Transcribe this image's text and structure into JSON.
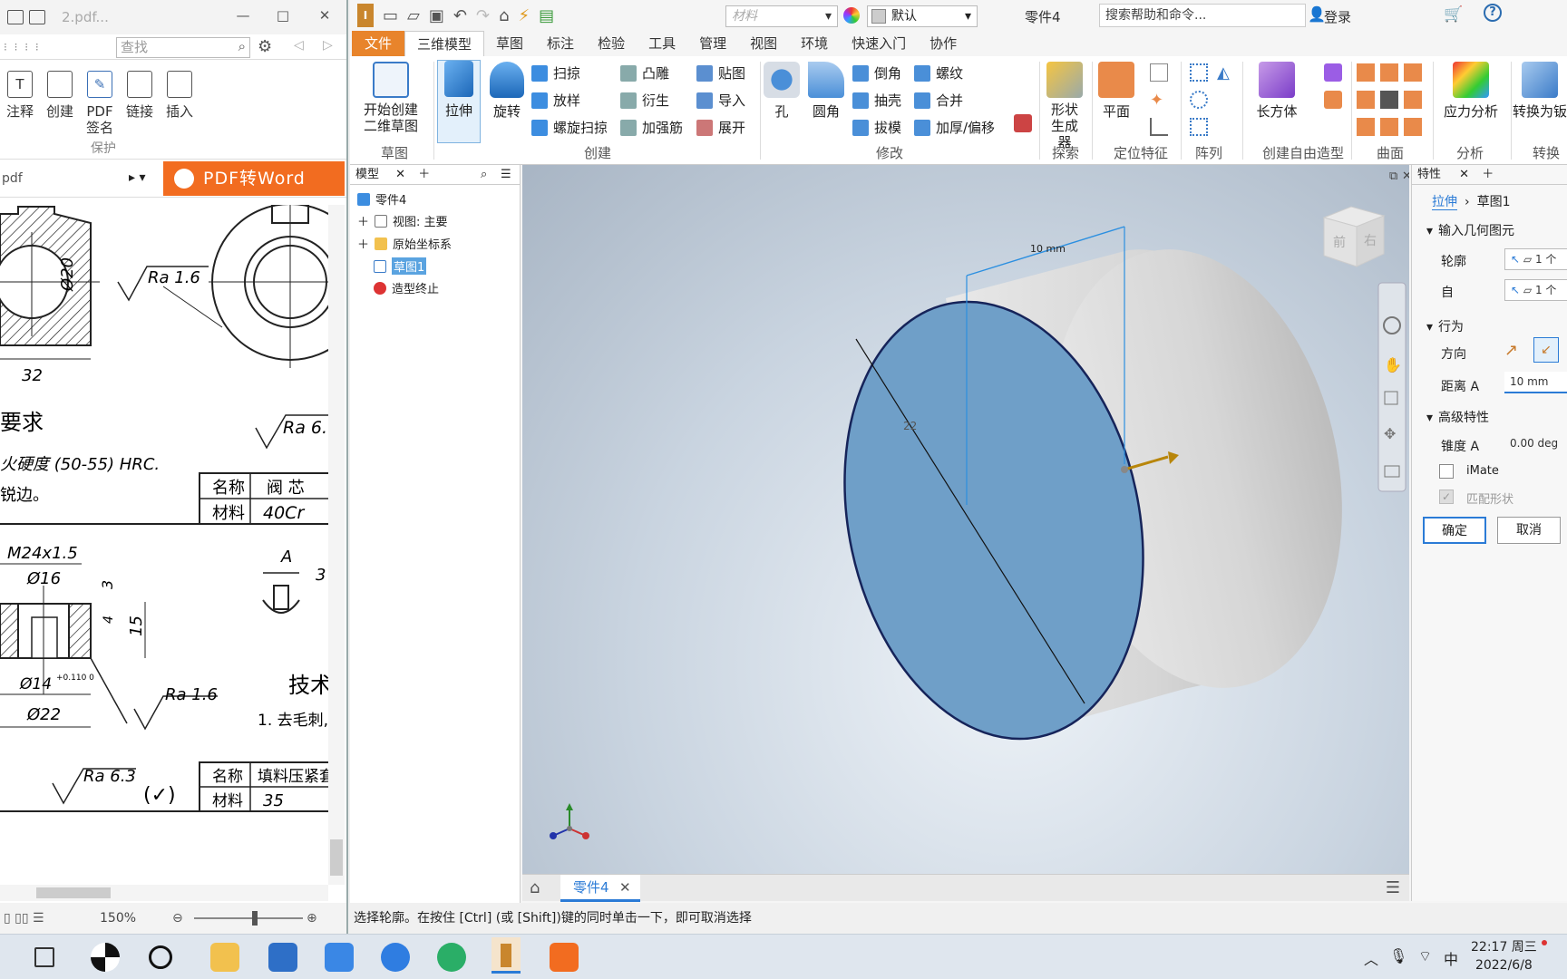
{
  "pdf_reader": {
    "file_name": "2.pdf...",
    "search_placeholder": "查找",
    "ribbon": [
      {
        "label": "注释",
        "icon": "text-icon"
      },
      {
        "label": "创建",
        "icon": "create-icon"
      },
      {
        "label": "PDF签名",
        "icon": "pen-icon"
      },
      {
        "label": "链接",
        "icon": "link-icon"
      },
      {
        "label": "插入",
        "icon": "insert-icon"
      }
    ],
    "ribbon_group": "保护",
    "tab_file": "pdf",
    "convert_banner": "PDF转Word",
    "zoom": "150%",
    "drawing": {
      "ra1": "Ra 1.6",
      "dia20": "Ø20",
      "dim32": "32",
      "req_title": "要求",
      "req_line1": "火硬度 (50-55) HRC.",
      "req_line2": "锐边。",
      "ra_top": "Ra 6.",
      "table1_r1": [
        "名称",
        "阀 芯"
      ],
      "table1_r2": [
        "材料",
        "40Cr"
      ],
      "thread": "M24x1.5",
      "dia16": "Ø16",
      "dim3": "3",
      "dim4": "4",
      "dim15": "15",
      "dia14": "Ø14",
      "tol": "+0.110 0",
      "dia22": "Ø22",
      "ra2": "Ra 1.6",
      "tech": "技术",
      "tech_line": "1. 去毛刺,",
      "sec_a": "A",
      "dim3b": "3",
      "ra63": "Ra 6.3",
      "check": "(✓)",
      "table2_r1": [
        "名称",
        "填料压紧套"
      ],
      "table2_r2": [
        "材料",
        "35"
      ]
    }
  },
  "inventor": {
    "material_placeholder": "材料",
    "appearance": "默认",
    "part_name": "零件4",
    "help_search": "搜索帮助和命令...",
    "login": "登录",
    "menu_tabs": [
      "文件",
      "三维模型",
      "草图",
      "标注",
      "检验",
      "工具",
      "管理",
      "视图",
      "环境",
      "快速入门",
      "协作"
    ],
    "active_tab": "三维模型",
    "ribbon": {
      "sketch_btn": "开始创建二维草图",
      "sketch_group": "草图",
      "extrude": "拉伸",
      "revolve": "旋转",
      "sweep": "扫掠",
      "loft": "放样",
      "coil": "螺旋扫掠",
      "emboss": "凸雕",
      "derive": "衍生",
      "rib": "加强筋",
      "decal": "贴图",
      "import": "导入",
      "unfold": "展开",
      "create_group": "创建",
      "hole": "孔",
      "fillet": "圆角",
      "chamfer": "倒角",
      "shell": "抽壳",
      "draft": "拔模",
      "thread": "螺纹",
      "combine": "合并",
      "thicken": "加厚/偏移",
      "modify_group": "修改",
      "shape_gen": "形状生成器",
      "explore_group": "探索",
      "plane": "平面",
      "workfeat_group": "定位特征",
      "pattern_group": "阵列",
      "box": "长方体",
      "freeform_group": "创建自由造型",
      "surface_group": "曲面",
      "stress": "应力分析",
      "analysis_group": "分析",
      "convert": "转换为钣",
      "convert_group": "转换"
    },
    "browser": {
      "tab": "模型",
      "root": "零件4",
      "items": [
        "视图: 主要",
        "原始坐标系",
        "草图1",
        "造型终止"
      ]
    },
    "viewport": {
      "dim_distance": "10 mm",
      "dim_diameter": "22",
      "viewcube_front": "前",
      "viewcube_right": "右",
      "doc_tab": "零件4"
    },
    "properties": {
      "tab": "特性",
      "breadcrumb_feature": "拉伸",
      "breadcrumb_sketch": "草图1",
      "section_input": "输入几何图元",
      "profile_label": "轮廓",
      "profile_value": "1 个",
      "from_label": "自",
      "from_value": "1 个",
      "section_behavior": "行为",
      "direction_label": "方向",
      "distance_label": "距离 A",
      "distance_value": "10 mm",
      "section_advanced": "高级特性",
      "taper_label": "锥度 A",
      "taper_value": "0.00 deg",
      "imate_label": "iMate",
      "match_shape_label": "匹配形状",
      "ok": "确定",
      "cancel": "取消"
    },
    "status_text": "选择轮廓。在按住 [Ctrl] (或 [Shift])键的同时单击一下，即可取消选择"
  },
  "taskbar": {
    "ime": "中",
    "time": "22:17 周三",
    "date": "2022/6/8"
  },
  "colors": {
    "inventor_file_tab": "#e8842b",
    "pdf_banner": "#f26c20",
    "face_blue": "#6f9fc8",
    "selection_blue": "#2b7bd6"
  }
}
